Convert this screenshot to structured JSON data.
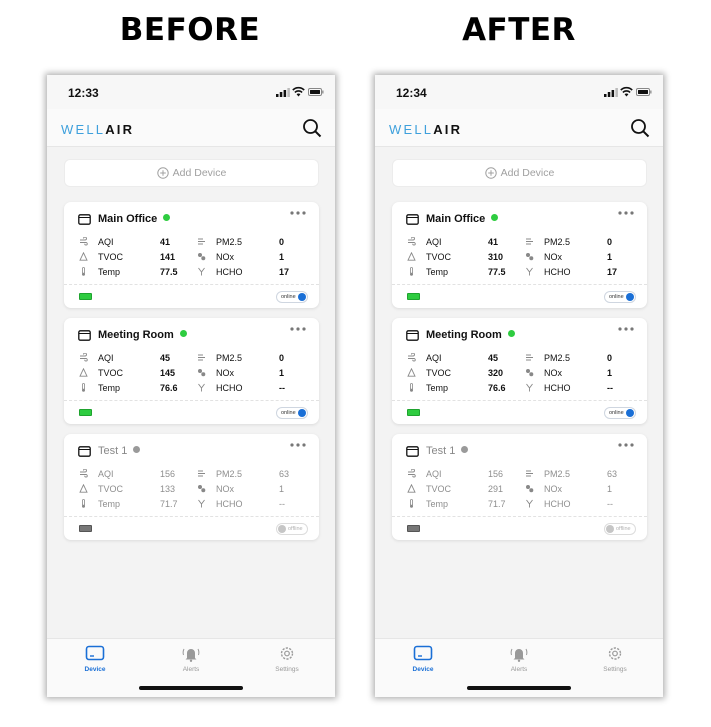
{
  "titles": {
    "before": "BEFORE",
    "after": "AFTER"
  },
  "colors": {
    "brand_light": "#3ea0dc",
    "online_green": "#2ecc40",
    "offline_gray": "#9a9a9a",
    "accent_blue": "#1a6fd6"
  },
  "app": {
    "brand_part1": "WELL",
    "brand_part2": "AIR",
    "add_device": "Add Device",
    "tabs": {
      "device": "Device",
      "alerts": "Alerts",
      "settings": "Settings"
    }
  },
  "labels": {
    "aqi": "AQI",
    "pm25": "PM2.5",
    "tvoc": "TVOC",
    "nox": "NOx",
    "temp": "Temp",
    "hcho": "HCHO",
    "online": "online",
    "offline": "offline"
  },
  "icons": [
    "signal-icon",
    "wifi-icon",
    "battery-icon",
    "search-icon",
    "plus-circle-icon",
    "monitor-icon",
    "more-icon",
    "wind-icon",
    "molecule-icon",
    "leaf-icon",
    "thermometer-icon",
    "flask-icon",
    "battery-badge-icon",
    "tablet-icon",
    "bell-icon",
    "gear-icon"
  ],
  "before": {
    "time": "12:33",
    "devices": [
      {
        "name": "Main Office",
        "status": "online",
        "aqi": "41",
        "pm25": "0",
        "tvoc": "141",
        "nox": "1",
        "temp": "77.5",
        "hcho": "17"
      },
      {
        "name": "Meeting Room",
        "status": "online",
        "aqi": "45",
        "pm25": "0",
        "tvoc": "145",
        "nox": "1",
        "temp": "76.6",
        "hcho": "--"
      },
      {
        "name": "Test 1",
        "status": "offline",
        "aqi": "156",
        "pm25": "63",
        "tvoc": "133",
        "nox": "1",
        "temp": "71.7",
        "hcho": "--"
      }
    ]
  },
  "after": {
    "time": "12:34",
    "devices": [
      {
        "name": "Main Office",
        "status": "online",
        "aqi": "41",
        "pm25": "0",
        "tvoc": "310",
        "nox": "1",
        "temp": "77.5",
        "hcho": "17"
      },
      {
        "name": "Meeting Room",
        "status": "online",
        "aqi": "45",
        "pm25": "0",
        "tvoc": "320",
        "nox": "1",
        "temp": "76.6",
        "hcho": "--"
      },
      {
        "name": "Test 1",
        "status": "offline",
        "aqi": "156",
        "pm25": "63",
        "tvoc": "291",
        "nox": "1",
        "temp": "71.7",
        "hcho": "--"
      }
    ]
  }
}
